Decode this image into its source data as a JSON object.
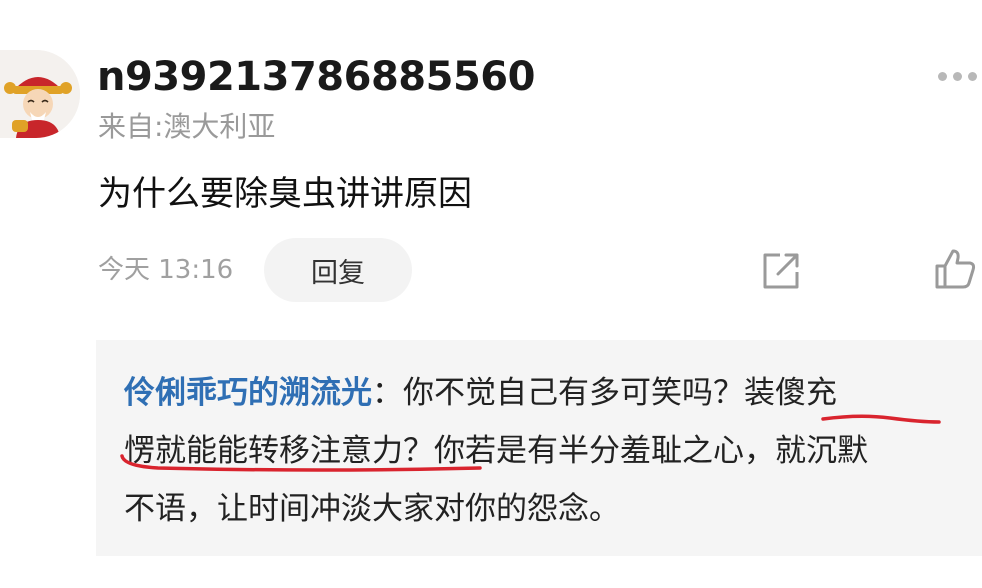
{
  "comment": {
    "username": "n939213786885560",
    "location": "来自:澳大利亚",
    "text": "为什么要除臭虫讲讲原因",
    "time": "今天 13:16",
    "reply_label": "回复"
  },
  "icons": {
    "avatar": "avatar-image",
    "more": "more-dots-icon",
    "share": "share-icon",
    "like": "thumbs-up-icon"
  },
  "reply": {
    "author": "伶俐乖巧的溯流光",
    "separator": "：",
    "line1": "你不觉自己有多可笑吗？装傻充",
    "line2": "愣就能能转移注意力？你若是有半分羞耻之心，就沉默",
    "line3": "不语，让时间冲淡大家对你的怨念。"
  },
  "colors": {
    "author": "#2f6fb4",
    "annotation": "#d9242e",
    "muted": "#9a9a9a",
    "reply_bg": "#f5f5f5"
  }
}
